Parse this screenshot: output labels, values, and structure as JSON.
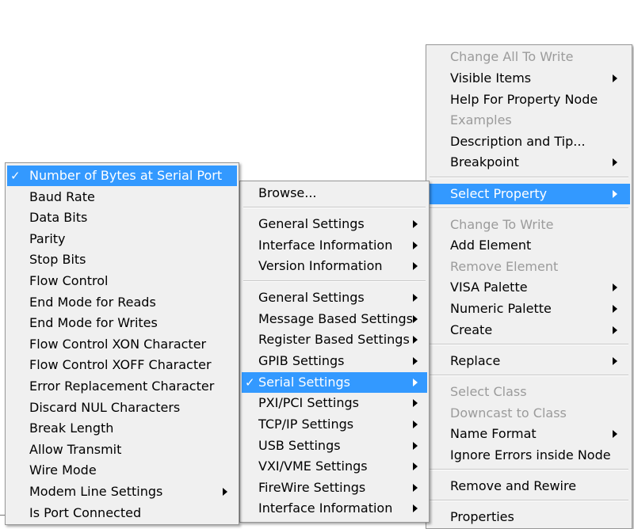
{
  "colors": {
    "menu_bg": "#f0f0f0",
    "highlight": "#3399ff",
    "disabled_text": "#9b9b9b"
  },
  "context_menu": {
    "items": [
      {
        "label": "Change All To Write",
        "disabled": true
      },
      {
        "label": "Visible Items",
        "submenu": true
      },
      {
        "label": "Help For Property Node"
      },
      {
        "label": "Examples",
        "disabled": true
      },
      {
        "label": "Description and Tip..."
      },
      {
        "label": "Breakpoint",
        "submenu": true
      },
      {
        "label": "Select Property",
        "submenu": true,
        "selected": true
      },
      {
        "label": "Change To Write",
        "disabled": true
      },
      {
        "label": "Add Element"
      },
      {
        "label": "Remove Element",
        "disabled": true
      },
      {
        "label": "VISA Palette",
        "submenu": true
      },
      {
        "label": "Numeric Palette",
        "submenu": true
      },
      {
        "label": "Create",
        "submenu": true
      },
      {
        "label": "Replace",
        "submenu": true
      },
      {
        "label": "Select Class",
        "disabled": true
      },
      {
        "label": "Downcast to Class",
        "disabled": true
      },
      {
        "label": "Name Format",
        "submenu": true
      },
      {
        "label": "Ignore Errors inside Node"
      },
      {
        "label": "Remove and Rewire"
      },
      {
        "label": "Properties"
      }
    ]
  },
  "property_menu": {
    "items": [
      {
        "label": "Browse..."
      },
      {
        "label": "General Settings",
        "submenu": true
      },
      {
        "label": "Interface Information",
        "submenu": true
      },
      {
        "label": "Version Information",
        "submenu": true
      },
      {
        "label": "General Settings",
        "submenu": true
      },
      {
        "label": "Message Based Settings",
        "submenu": true
      },
      {
        "label": "Register Based Settings",
        "submenu": true
      },
      {
        "label": "GPIB Settings",
        "submenu": true
      },
      {
        "label": "Serial Settings",
        "submenu": true,
        "selected": true,
        "checked": true
      },
      {
        "label": "PXI/PCI Settings",
        "submenu": true
      },
      {
        "label": "TCP/IP Settings",
        "submenu": true
      },
      {
        "label": "USB Settings",
        "submenu": true
      },
      {
        "label": "VXI/VME Settings",
        "submenu": true
      },
      {
        "label": "FireWire Settings",
        "submenu": true
      },
      {
        "label": "Interface Information",
        "submenu": true
      }
    ]
  },
  "serial_menu": {
    "items": [
      {
        "label": "Number of Bytes at Serial Port",
        "selected": true,
        "checked": true
      },
      {
        "label": "Baud Rate"
      },
      {
        "label": "Data Bits"
      },
      {
        "label": "Parity"
      },
      {
        "label": "Stop Bits"
      },
      {
        "label": "Flow Control"
      },
      {
        "label": "End Mode for Reads"
      },
      {
        "label": "End Mode for Writes"
      },
      {
        "label": "Flow Control XON Character"
      },
      {
        "label": "Flow Control XOFF Character"
      },
      {
        "label": "Error Replacement Character"
      },
      {
        "label": "Discard NUL Characters"
      },
      {
        "label": "Break Length"
      },
      {
        "label": "Allow Transmit"
      },
      {
        "label": "Wire Mode"
      },
      {
        "label": "Modem Line Settings",
        "submenu": true
      },
      {
        "label": "Is Port Connected"
      }
    ]
  },
  "checkmark": "✓"
}
